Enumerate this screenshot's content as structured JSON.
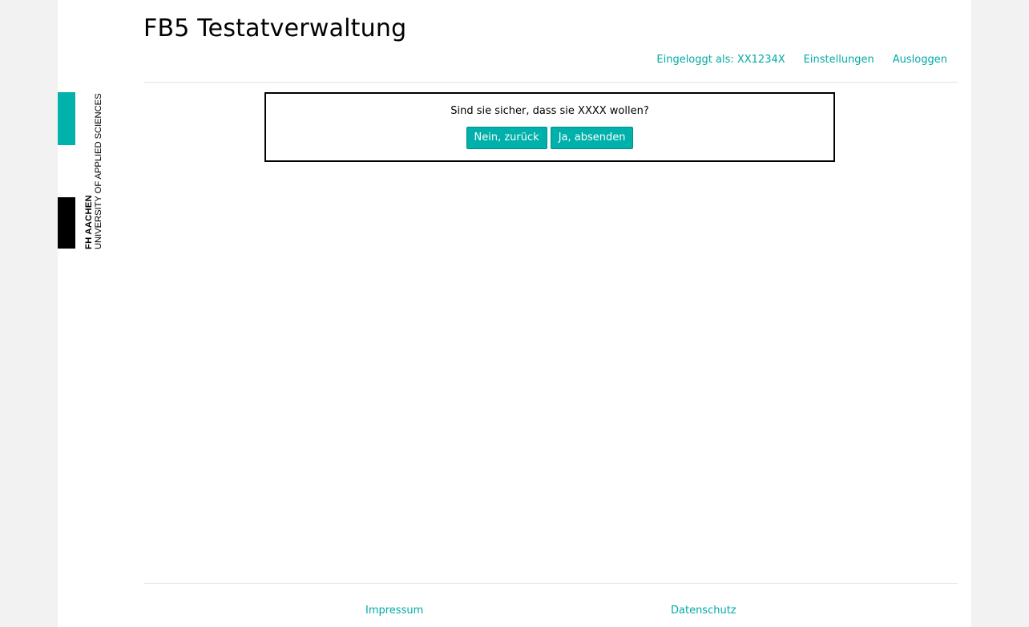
{
  "header": {
    "title": "FB5 Testatverwaltung",
    "nav": {
      "logged_in": "Eingeloggt als: XX1234X",
      "settings": "Einstellungen",
      "logout": "Ausloggen"
    }
  },
  "logo": {
    "line1": "FH AACHEN",
    "line2": "UNIVERSITY OF APPLIED SCIENCES",
    "colors": {
      "accent": "#00b1ac",
      "dark": "#000000"
    }
  },
  "dialog": {
    "question": "Sind sie sicher, dass sie XXXX wollen?",
    "cancel_label": "Nein, zurück",
    "confirm_label": "Ja, absenden"
  },
  "footer": {
    "impressum": "Impressum",
    "datenschutz": "Datenschutz"
  },
  "colors": {
    "link": "#00aba6",
    "button": "#00b0ab",
    "background": "#f2f2f2"
  }
}
